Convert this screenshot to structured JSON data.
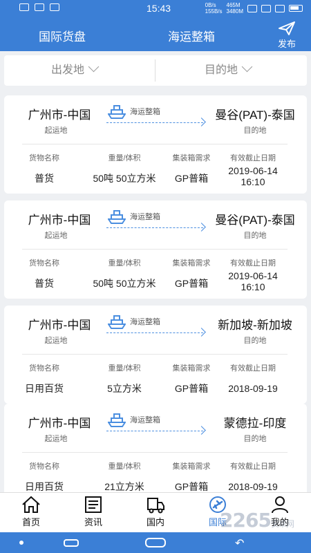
{
  "status_bar": {
    "time": "15:43",
    "network_speed_up": "0B/s",
    "network_speed_down": "155B/s",
    "battery_mah": "465M",
    "battery_mah2": "3480M"
  },
  "header": {
    "tab_market": "国际货盘",
    "title": "海运整箱",
    "publish_label": "发布"
  },
  "filter": {
    "origin_label": "出发地",
    "destination_label": "目的地"
  },
  "cards": [
    {
      "origin": "广州市-中国",
      "origin_label": "起运地",
      "transport": "海运整箱",
      "destination": "曼谷(PAT)-泰国",
      "destination_label": "目的地",
      "cargo_header": "货物名称",
      "cargo": "普货",
      "weight_header": "重量/体积",
      "weight": "50吨 50立方米",
      "container_header": "集装箱需求",
      "container": "GP普箱",
      "deadline_header": "有效截止日期",
      "deadline_date": "2019-06-14",
      "deadline_time": "16:10"
    },
    {
      "origin": "广州市-中国",
      "origin_label": "起运地",
      "transport": "海运整箱",
      "destination": "曼谷(PAT)-泰国",
      "destination_label": "目的地",
      "cargo_header": "货物名称",
      "cargo": "普货",
      "weight_header": "重量/体积",
      "weight": "50吨 50立方米",
      "container_header": "集装箱需求",
      "container": "GP普箱",
      "deadline_header": "有效截止日期",
      "deadline_date": "2019-06-14",
      "deadline_time": "16:10"
    },
    {
      "origin": "广州市-中国",
      "origin_label": "起运地",
      "transport": "海运整箱",
      "destination": "新加坡-新加坡",
      "destination_label": "目的地",
      "cargo_header": "货物名称",
      "cargo": "日用百货",
      "weight_header": "重量/体积",
      "weight": "5立方米",
      "container_header": "集装箱需求",
      "container": "GP普箱",
      "deadline_header": "有效截止日期",
      "deadline_date": "2018-09-19",
      "deadline_time": ""
    },
    {
      "origin": "广州市-中国",
      "origin_label": "起运地",
      "transport": "海运整箱",
      "destination": "蒙德拉-印度",
      "destination_label": "目的地",
      "cargo_header": "货物名称",
      "cargo": "日用百货",
      "weight_header": "重量/体积",
      "weight": "21立方米",
      "container_header": "集装箱需求",
      "container": "GP普箱",
      "deadline_header": "有效截止日期",
      "deadline_date": "2018-09-19",
      "deadline_time": ""
    }
  ],
  "tabbar": {
    "items": [
      {
        "label": "首页",
        "icon": "home-icon"
      },
      {
        "label": "资讯",
        "icon": "news-icon"
      },
      {
        "label": "国内",
        "icon": "truck-icon"
      },
      {
        "label": "国际",
        "icon": "plane-icon",
        "active": true
      },
      {
        "label": "我的",
        "icon": "user-icon"
      }
    ]
  },
  "watermark": {
    "text": "2265",
    "suffix": "安卓网"
  },
  "colors": {
    "primary": "#3b7fd6",
    "background": "#eef0f3",
    "route": "#4a8ee0"
  }
}
